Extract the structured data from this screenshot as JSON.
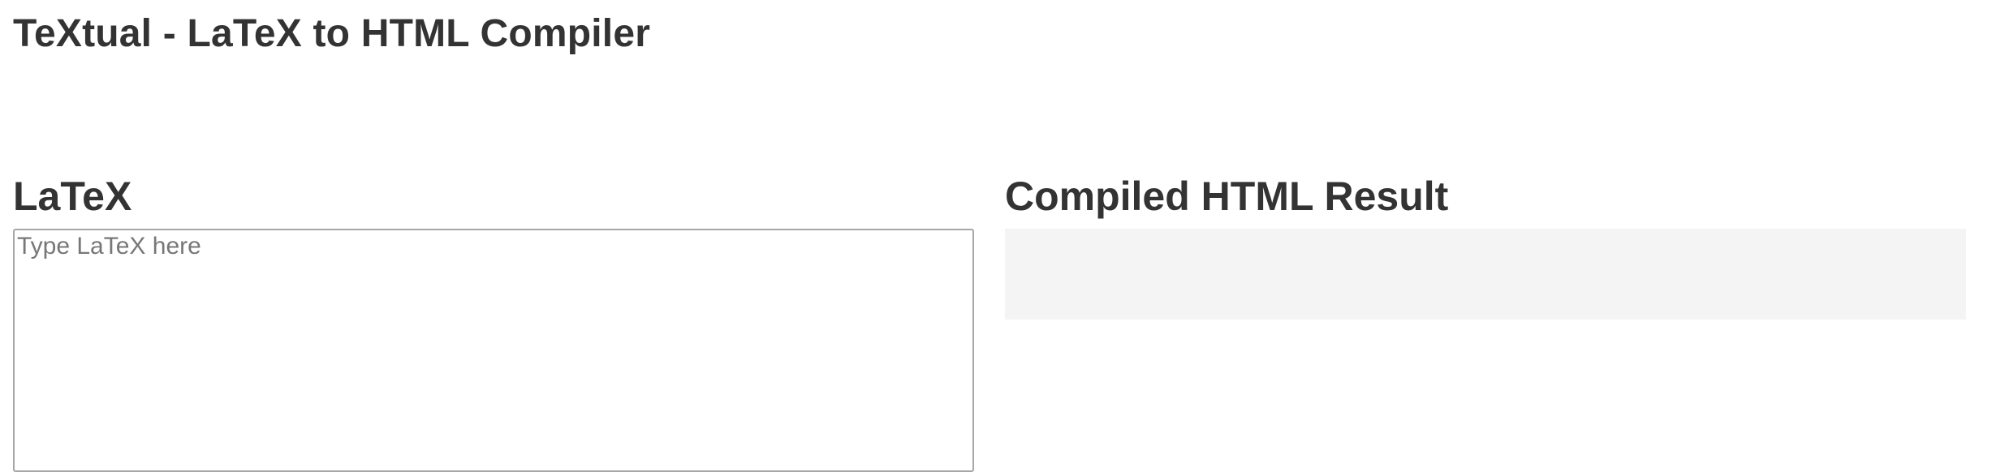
{
  "header": {
    "title": "TeXtual - LaTeX to HTML Compiler"
  },
  "editor": {
    "heading": "LaTeX",
    "placeholder": "Type LaTeX here",
    "value": ""
  },
  "result": {
    "heading": "Compiled HTML Result",
    "content": ""
  },
  "colors": {
    "text": "#333333",
    "placeholder": "#777777",
    "result_background": "#f4f4f4",
    "input_border": "#a7a7a7"
  }
}
